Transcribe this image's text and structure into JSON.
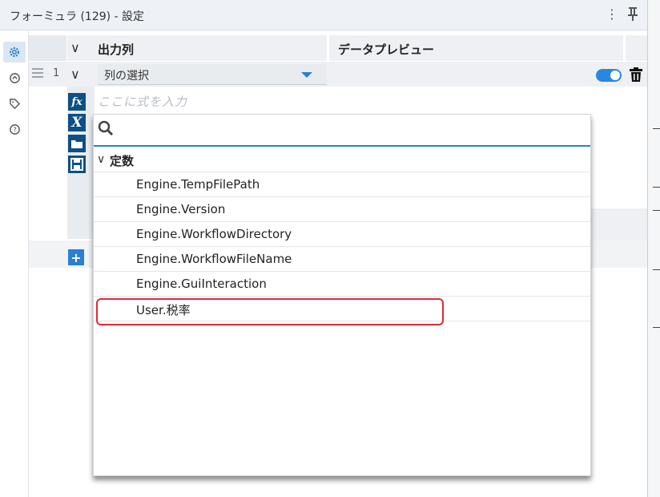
{
  "window": {
    "title": "フォーミュラ (129) - 設定"
  },
  "leftbar": {
    "icons": [
      "gear-icon",
      "arrow-circle-icon",
      "tag-icon",
      "help-icon"
    ]
  },
  "grid": {
    "header": {
      "output_column": "出力列",
      "data_preview": "データプレビュー"
    },
    "row": {
      "number": "1",
      "select_value": "列の選択",
      "enabled": true
    },
    "expression": {
      "placeholder": "ここに式を入力"
    }
  },
  "popup": {
    "search_value": "",
    "group": "定数",
    "items": [
      "Engine.TempFilePath",
      "Engine.Version",
      "Engine.WorkflowDirectory",
      "Engine.WorkflowFileName",
      "Engine.GuiInteraction",
      "User.税率"
    ],
    "highlighted_item": "User.税率"
  },
  "colors": {
    "accent": "#2a7fd4",
    "icon_dark": "#0d4f87",
    "highlight": "#e02a36"
  }
}
